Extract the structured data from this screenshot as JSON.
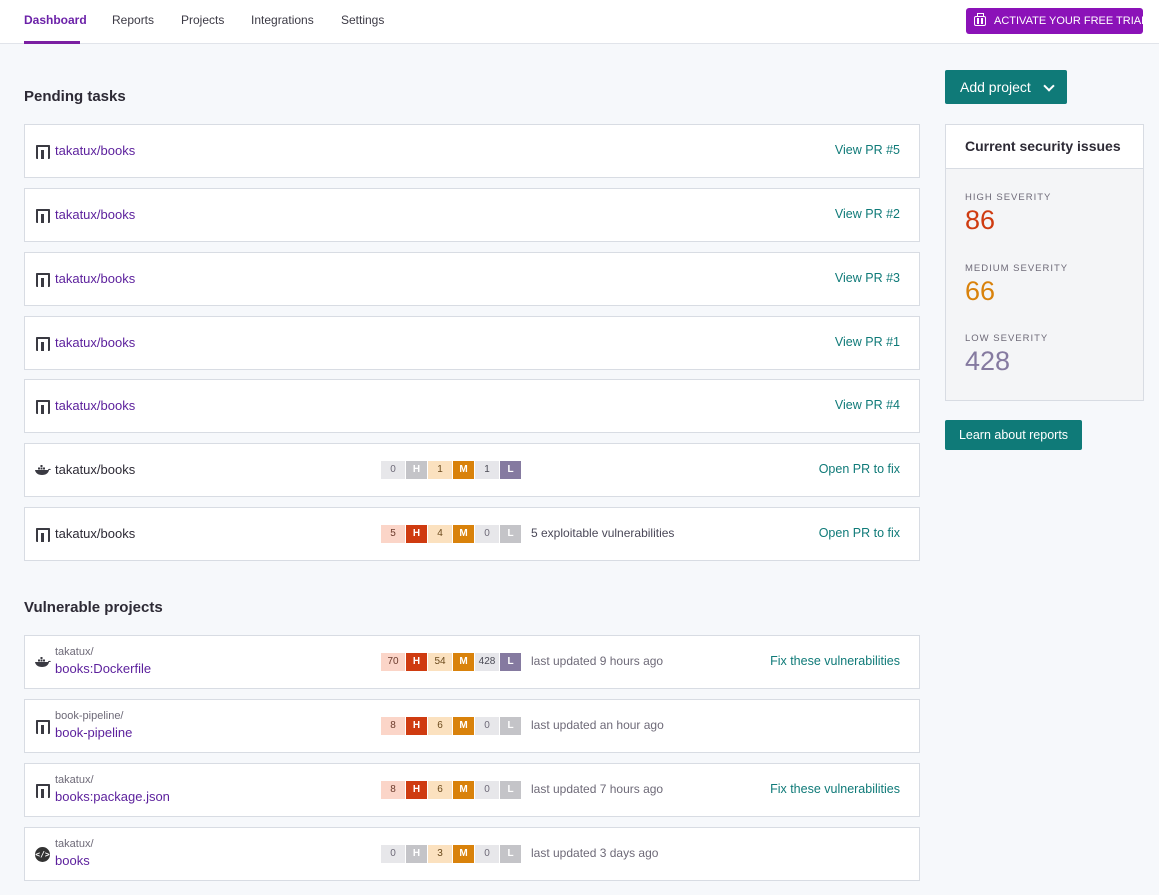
{
  "nav": {
    "tabs": [
      "Dashboard",
      "Reports",
      "Projects",
      "Integrations",
      "Settings"
    ],
    "active_tab": "Dashboard",
    "trial_button": "ACTIVATE YOUR FREE TRIAL"
  },
  "pending": {
    "title": "Pending tasks",
    "items": [
      {
        "icon": "repo-icon",
        "name": "takatux/books",
        "action": "View PR #5"
      },
      {
        "icon": "repo-icon",
        "name": "takatux/books",
        "action": "View PR #2"
      },
      {
        "icon": "repo-icon",
        "name": "takatux/books",
        "action": "View PR #3"
      },
      {
        "icon": "repo-icon",
        "name": "takatux/books",
        "action": "View PR #1"
      },
      {
        "icon": "repo-icon",
        "name": "takatux/books",
        "action": "View PR #4"
      },
      {
        "icon": "docker-icon",
        "name": "takatux/books",
        "high": "0",
        "medium": "1",
        "low": "1",
        "extra": "",
        "action": "Open PR to fix"
      },
      {
        "icon": "repo-icon",
        "name": "takatux/books",
        "high": "5",
        "medium": "4",
        "low": "0",
        "extra": "5 exploitable vulnerabilities",
        "action": "Open PR to fix"
      }
    ]
  },
  "vulnerable": {
    "title": "Vulnerable projects",
    "items": [
      {
        "icon": "docker-icon",
        "owner": "takatux/",
        "name": "books:Dockerfile",
        "high": "70",
        "medium": "54",
        "low": "428",
        "updated": "last updated 9 hours ago",
        "action": "Fix these vulnerabilities"
      },
      {
        "icon": "repo-icon",
        "owner": "book-pipeline/",
        "name": "book-pipeline",
        "high": "8",
        "medium": "6",
        "low": "0",
        "updated": "last updated an hour ago",
        "action": ""
      },
      {
        "icon": "repo-icon",
        "owner": "takatux/",
        "name": "books:package.json",
        "high": "8",
        "medium": "6",
        "low": "0",
        "updated": "last updated 7 hours ago",
        "action": "Fix these vulnerabilities"
      },
      {
        "icon": "code-icon",
        "owner": "takatux/",
        "name": "books",
        "high": "0",
        "medium": "3",
        "low": "0",
        "updated": "last updated 3 days ago",
        "action": ""
      }
    ]
  },
  "badges": {
    "high": "H",
    "medium": "M",
    "low": "L"
  },
  "sidebar": {
    "add_project": "Add project",
    "issues_title": "Current security issues",
    "high_label": "HIGH SEVERITY",
    "high_value": "86",
    "medium_label": "MEDIUM SEVERITY",
    "medium_value": "66",
    "low_label": "LOW SEVERITY",
    "low_value": "428",
    "learn_button": "Learn about reports"
  },
  "colors": {
    "brand_purple": "#8b12b8",
    "teal": "#0f7a78",
    "high": "#cf3b10",
    "medium": "#d9820b",
    "low": "#857aa0"
  }
}
